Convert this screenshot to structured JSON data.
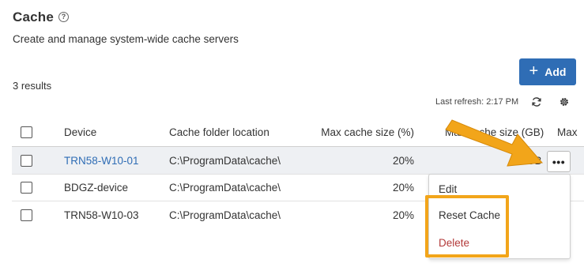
{
  "header": {
    "title": "Cache",
    "help_icon": "?",
    "subtitle": "Create and manage system-wide cache servers"
  },
  "toolbar": {
    "add_label": "Add",
    "results_count": "3 results",
    "last_refresh": "Last refresh: 2:17 PM"
  },
  "table": {
    "columns": [
      "Device",
      "Cache folder location",
      "Max cache size (%)",
      "Max cache size (GB)",
      "Max"
    ],
    "rows": [
      {
        "device": "TRN58-W10-01",
        "location": "C:\\ProgramData\\cache\\",
        "pct": "20%",
        "gb": "GB"
      },
      {
        "device": "BDGZ-device",
        "location": "C:\\ProgramData\\cache\\",
        "pct": "20%",
        "gb": ""
      },
      {
        "device": "TRN58-W10-03",
        "location": "C:\\ProgramData\\cache\\",
        "pct": "20%",
        "gb": ""
      }
    ]
  },
  "row_actions": {
    "more_label": "•••",
    "menu": [
      "Edit",
      "Reset Cache",
      "Delete"
    ]
  },
  "colors": {
    "accent": "#2f6db5",
    "highlight": "#f2a51a",
    "danger": "#b33a3a"
  }
}
